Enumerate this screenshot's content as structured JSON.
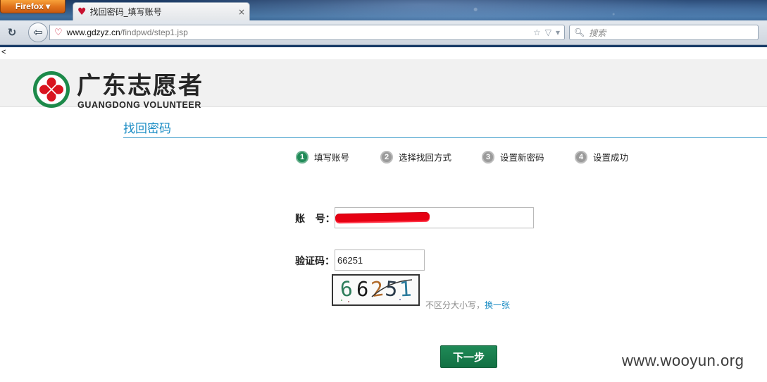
{
  "browser": {
    "app_button_label": "Firefox ▾",
    "tab_title": "找回密码_填写账号",
    "tab_close": "×",
    "url_host": "www.gdzyz.cn",
    "url_path": "/findpwd/step1.jsp",
    "search_placeholder": "搜索"
  },
  "page": {
    "stray_char": "<",
    "logo": {
      "cn": "广东志愿者",
      "en": "GUANGDONG VOLUNTEER"
    },
    "section_title": "找回密码",
    "steps": [
      {
        "num": "1",
        "label": "填写账号",
        "active": true
      },
      {
        "num": "2",
        "label": "选择找回方式",
        "active": false
      },
      {
        "num": "3",
        "label": "设置新密码",
        "active": false
      },
      {
        "num": "4",
        "label": "设置成功",
        "active": false
      }
    ],
    "form": {
      "account_label": "账   号：",
      "account_value": "",
      "captcha_label": "验证码：",
      "captcha_value": "66251",
      "captcha_image_text": [
        "6",
        "6",
        "2",
        "5",
        "1"
      ],
      "captcha_hint": "不区分大小写，",
      "captcha_refresh": "换一张",
      "next_button": "下一步"
    },
    "watermark": "www.wooyun.org",
    "colors": {
      "accent_blue": "#1a8cc4",
      "step_active": "#1f8a57",
      "step_inactive": "#9a9a9a",
      "button_green": "#1a7d4d",
      "redaction": "#e60012"
    }
  }
}
